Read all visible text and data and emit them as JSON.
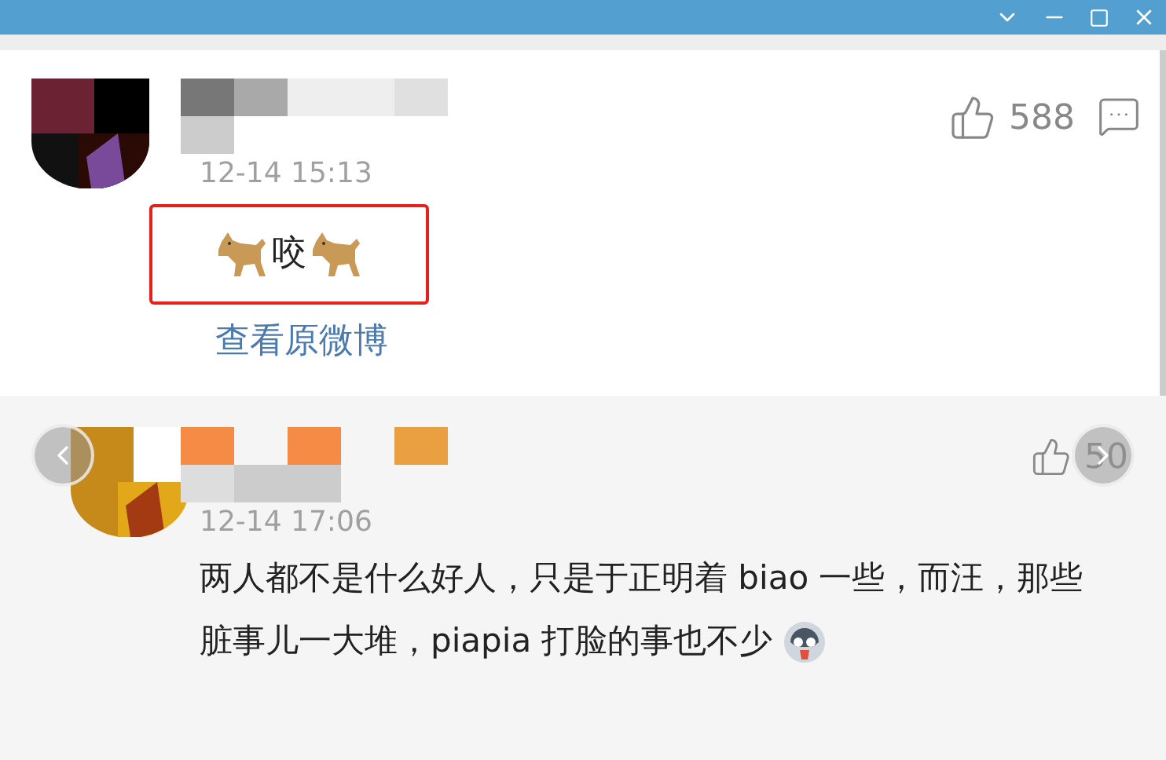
{
  "comments": [
    {
      "time": "12-14 15:13",
      "text": "咬",
      "highlighted": true,
      "link": "查看原微博",
      "likes": "588"
    },
    {
      "time": "12-14 17:06",
      "text": "两人都不是什么好人，只是于正明着 biao 一些，而汪，那些脏事儿一大堆，piapia 打脸的事也不少",
      "highlighted": false,
      "likes": "50"
    }
  ]
}
